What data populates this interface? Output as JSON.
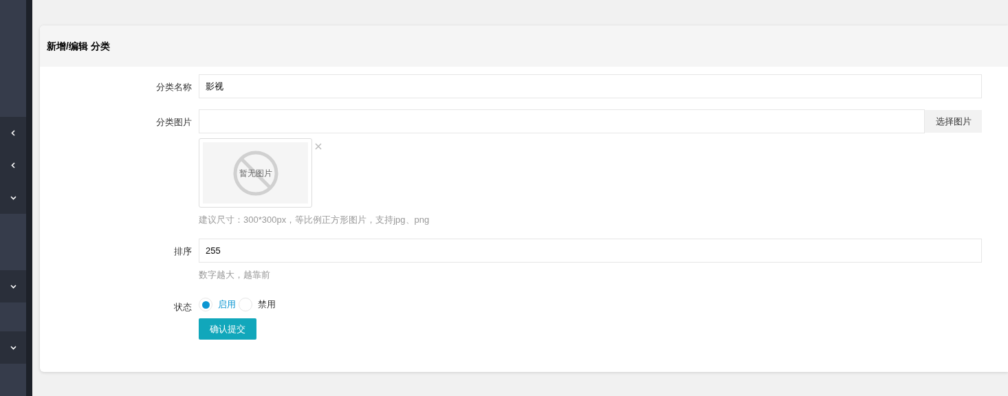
{
  "sidebar": {
    "items": [
      {
        "expanded": false
      },
      {
        "expanded": false
      },
      {
        "expanded": true
      },
      {
        "expanded": true
      },
      {
        "expanded": true
      }
    ]
  },
  "form": {
    "title": "新增/编辑 分类",
    "name": {
      "label": "分类名称",
      "value": "影视"
    },
    "image": {
      "label": "分类图片",
      "button": "选择图片",
      "preview_text": "暂无图片",
      "hint": "建议尺寸：300*300px，等比例正方形图片，支持jpg、png"
    },
    "sort": {
      "label": "排序",
      "value": "255",
      "hint": "数字越大，越靠前"
    },
    "status": {
      "label": "状态",
      "options": [
        {
          "label": "启用",
          "selected": true
        },
        {
          "label": "禁用",
          "selected": false
        }
      ]
    },
    "submit": "确认提交"
  }
}
